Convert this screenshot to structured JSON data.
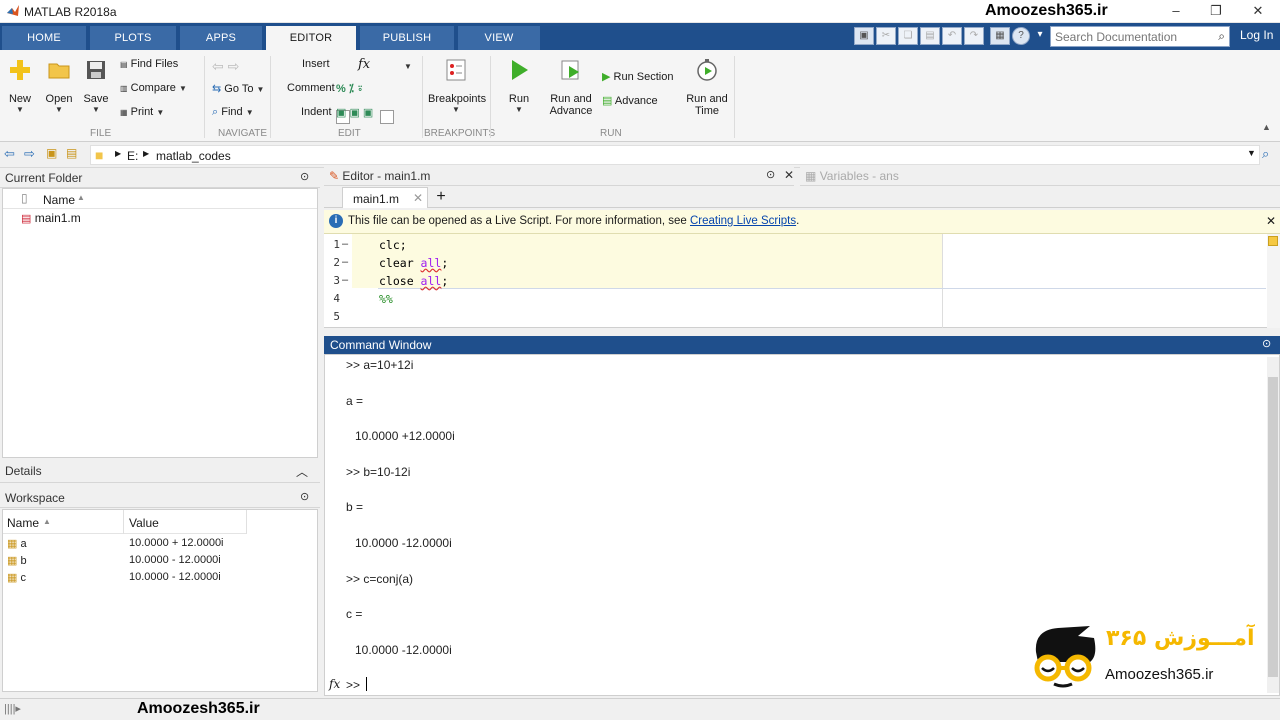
{
  "window": {
    "title": "MATLAB R2018a",
    "watermark_top": "Amoozesh365.ir"
  },
  "tabs": [
    "HOME",
    "PLOTS",
    "APPS",
    "EDITOR",
    "PUBLISH",
    "VIEW"
  ],
  "search": {
    "placeholder": "Search Documentation"
  },
  "login": "Log In",
  "ribbon": {
    "file": {
      "new": "New",
      "open": "Open",
      "save": "Save",
      "find_files": "Find Files",
      "compare": "Compare",
      "print": "Print",
      "label": "FILE"
    },
    "navigate": {
      "go_to": "Go To",
      "find": "Find",
      "label": "NAVIGATE"
    },
    "edit": {
      "insert": "Insert",
      "comment": "Comment",
      "indent": "Indent",
      "fx": "fx",
      "label": "EDIT"
    },
    "breakpoints": {
      "breakpoints": "Breakpoints",
      "label": "BREAKPOINTS"
    },
    "run": {
      "run": "Run",
      "run_and_advance_1": "Run and",
      "run_and_advance_2": "Advance",
      "run_section": "Run Section",
      "advance": "Advance",
      "run_and_time_1": "Run and",
      "run_and_time_2": "Time",
      "label": "RUN"
    }
  },
  "path": {
    "drive": "E:",
    "folder": "matlab_codes"
  },
  "current_folder": {
    "title": "Current Folder",
    "col_name": "Name",
    "files": [
      "main1.m"
    ]
  },
  "details": {
    "title": "Details"
  },
  "workspace": {
    "title": "Workspace",
    "col_name": "Name",
    "col_value": "Value",
    "rows": [
      {
        "name": "a",
        "value": "10.0000 + 12.0000i"
      },
      {
        "name": "b",
        "value": "10.0000 - 12.0000i"
      },
      {
        "name": "c",
        "value": "10.0000 - 12.0000i"
      }
    ]
  },
  "editor": {
    "title": "Editor - main1.m",
    "variables_title": "Variables - ans",
    "file_tab": "main1.m",
    "info_text": "This file can be opened as a Live Script. For more information, see ",
    "info_link": "Creating Live Scripts",
    "info_end": ".",
    "lines": [
      {
        "n": "1",
        "kw": "clc;",
        "arg": "",
        "end": ""
      },
      {
        "n": "2",
        "kw": "clear ",
        "arg": "all",
        "end": ";"
      },
      {
        "n": "3",
        "kw": "close ",
        "arg": "all",
        "end": ";"
      },
      {
        "n": "4",
        "kw": "",
        "arg": "",
        "end": "%%"
      },
      {
        "n": "5",
        "kw": "",
        "arg": "",
        "end": ""
      }
    ]
  },
  "command_window": {
    "title": "Command Window",
    "lines": [
      ">> a=10+12i",
      "a =",
      "10.0000 +12.0000i",
      ">> b=10-12i",
      "b =",
      "10.0000 -12.0000i",
      ">> c=conj(a)",
      "c =",
      "10.0000 -12.0000i"
    ],
    "prompt": ">>",
    "fx": "fx"
  },
  "branding": {
    "logo_text": "Amoozesh365.ir",
    "logo_persian": "آمـــوزش ۳۶۵",
    "bottom_watermark": "Amoozesh365.ir"
  },
  "colors": {
    "tab_bar": "#1f4f8c",
    "link": "#0645ad",
    "banner": "#fdfbe0",
    "logo_yellow": "#f5b800"
  }
}
